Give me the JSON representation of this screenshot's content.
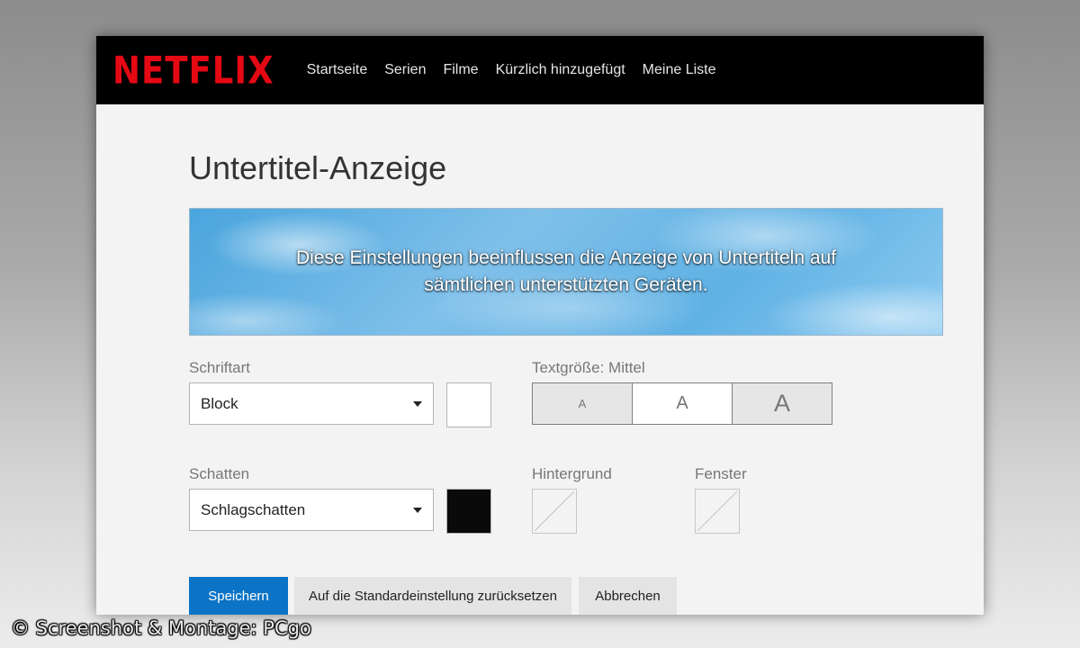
{
  "header": {
    "logo": "NETFLIX",
    "nav": [
      "Startseite",
      "Serien",
      "Filme",
      "Kürzlich hinzugefügt",
      "Meine Liste"
    ]
  },
  "page": {
    "title": "Untertitel-Anzeige",
    "banner_text": "Diese Einstellungen beeinflussen die Anzeige von Untertiteln auf sämtlichen unterstützten Geräten."
  },
  "font": {
    "label": "Schriftart",
    "value": "Block",
    "color": "#ffffff"
  },
  "text_size": {
    "label": "Textgröße: Mittel",
    "options": [
      "A",
      "A",
      "A"
    ],
    "selected": "medium"
  },
  "shadow": {
    "label": "Schatten",
    "value": "Schlagschatten",
    "color": "#0a0a0a"
  },
  "background": {
    "label": "Hintergrund"
  },
  "window_option": {
    "label": "Fenster"
  },
  "actions": {
    "save": "Speichern",
    "reset": "Auf die Standardeinstellung zurücksetzen",
    "cancel": "Abbrechen"
  },
  "copyright": "© Screenshot & Montage: PCgo"
}
